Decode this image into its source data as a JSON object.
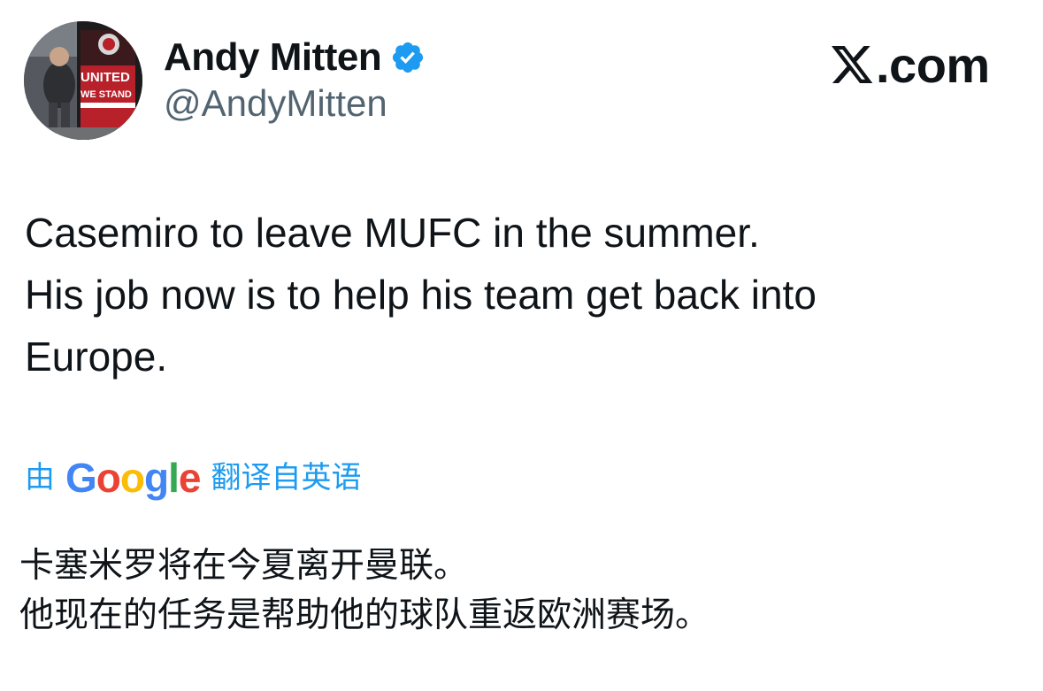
{
  "author": {
    "display_name": "Andy Mitten",
    "handle": "@AndyMitten",
    "verified": true,
    "avatar_icon": "profile-photo-icon",
    "avatar_text": [
      "UNITED",
      "WE STAND"
    ]
  },
  "brand": {
    "logo_icon": "x-logo-icon",
    "site": ".com"
  },
  "tweet": {
    "lines": [
      "Casemiro to leave MUFC in the summer.",
      "His job now is to help his team get back into",
      "Europe."
    ]
  },
  "translation": {
    "by_label": "由",
    "provider": {
      "name": "Google",
      "letters": [
        "G",
        "o",
        "o",
        "g",
        "l",
        "e"
      ],
      "colors": [
        "#4285F4",
        "#EA4335",
        "#FBBC05",
        "#4285F4",
        "#34A853",
        "#EA4335"
      ]
    },
    "from_label": "翻译自英语",
    "lines": [
      "卡塞米罗将在今夏离开曼联。",
      "他现在的任务是帮助他的球队重返欧洲赛场。"
    ]
  },
  "colors": {
    "text": "#0f1419",
    "secondary": "#536471",
    "accent": "#1d9bf0"
  }
}
